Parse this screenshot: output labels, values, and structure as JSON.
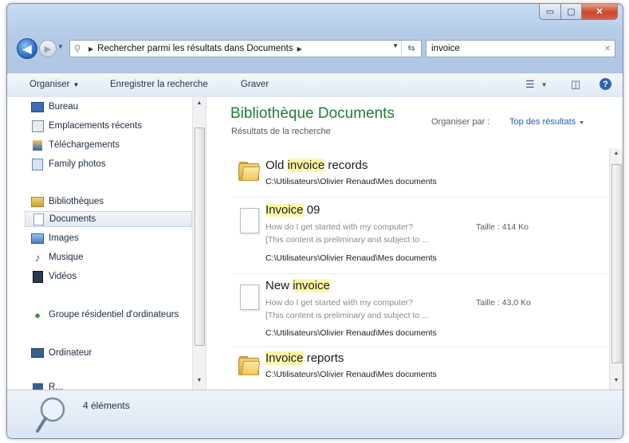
{
  "window": {
    "controls": {
      "minimize": "▭",
      "maximize": "▢",
      "close": "✕"
    }
  },
  "nav": {
    "back_icon": "arrow-left-icon",
    "forward_icon": "arrow-right-icon",
    "address_crumb": "Rechercher parmi les résultats dans Documents",
    "search_value": "invoice",
    "search_clear": "✕"
  },
  "toolbar": {
    "organize": "Organiser",
    "save_search": "Enregistrer la recherche",
    "burn": "Graver"
  },
  "sidebar": {
    "items": [
      {
        "label": "Bureau",
        "icon": "desktop-icon",
        "color": "#3b6db3"
      },
      {
        "label": "Emplacements récents",
        "icon": "recent-places-icon",
        "color": "#7a8aa0"
      },
      {
        "label": "Téléchargements",
        "icon": "downloads-icon",
        "color": "#2f66b0"
      },
      {
        "label": "Family photos",
        "icon": "folder-link-icon",
        "color": "#6b89b8"
      },
      {
        "label": "Bibliothèques",
        "icon": "libraries-icon",
        "color": "#c8a23a"
      },
      {
        "label": "Documents",
        "icon": "document-library-icon",
        "color": "#8aa0b8"
      },
      {
        "label": "Images",
        "icon": "pictures-icon",
        "color": "#4a7bbf"
      },
      {
        "label": "Musique",
        "icon": "music-icon",
        "color": "#2a6db8"
      },
      {
        "label": "Vidéos",
        "icon": "video-icon",
        "color": "#2a3a55"
      },
      {
        "label": "Groupe résidentiel d'ordinateurs",
        "icon": "homegroup-icon",
        "color": "#3f8f3f"
      },
      {
        "label": "Ordinateur",
        "icon": "computer-icon",
        "color": "#3a5f8f"
      },
      {
        "label": "R...",
        "icon": "network-icon",
        "color": "#3a5f8f"
      }
    ]
  },
  "content": {
    "library_title": "Bibliothèque Documents",
    "library_subtitle": "Résultats de la recherche",
    "arrange_label": "Organiser par :",
    "arrange_value": "Top des résultats",
    "results": [
      {
        "type": "folder",
        "title_pre": "Old ",
        "title_hl": "invoice",
        "title_post": " records",
        "snippet1": "",
        "snippet2": "",
        "size": "",
        "path": "C:\\Utilisateurs\\Olivier Renaud\\Mes documents"
      },
      {
        "type": "document",
        "title_pre": "",
        "title_hl": "Invoice",
        "title_post": " 09",
        "snippet1": "How do I get started with my computer?",
        "snippet2": "[This content is preliminary and subject to ...",
        "size": "Taille : 414 Ko",
        "path": "C:\\Utilisateurs\\Olivier Renaud\\Mes documents"
      },
      {
        "type": "document",
        "title_pre": "New ",
        "title_hl": "invoice",
        "title_post": "",
        "snippet1": "How do I get started with my computer?",
        "snippet2": "[This content is preliminary and subject to ...",
        "size": "Taille : 43,0 Ko",
        "path": "C:\\Utilisateurs\\Olivier Renaud\\Mes documents"
      },
      {
        "type": "folder",
        "title_pre": "",
        "title_hl": "Invoice",
        "title_post": " reports",
        "snippet1": "",
        "snippet2": "",
        "size": "",
        "path": "C:\\Utilisateurs\\Olivier Renaud\\Mes documents"
      }
    ]
  },
  "details": {
    "count": "4 éléments",
    "icon": "search-magnifier-icon"
  },
  "colors": {
    "accent_title": "#1e7e34",
    "highlight": "#fff7a8",
    "link": "#1f5fb0"
  }
}
